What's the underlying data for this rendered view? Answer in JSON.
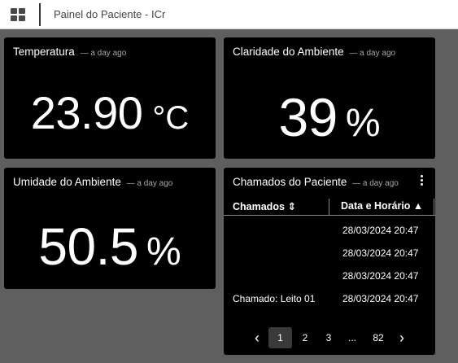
{
  "topbar": {
    "title": "Painel do Paciente - ICr"
  },
  "cards": {
    "temperature": {
      "title": "Temperatura",
      "ago": "— a day ago",
      "value": "23.90",
      "unit": "°C"
    },
    "brightness": {
      "title": "Claridade do Ambiente",
      "ago": "— a day ago",
      "value": "39",
      "unit": "%"
    },
    "humidity": {
      "title": "Umidade do Ambiente",
      "ago": "— a day ago",
      "value": "50.5",
      "unit": "%"
    },
    "calls": {
      "title": "Chamados do Paciente",
      "ago": "— a day ago",
      "columns": {
        "calls": "Chamados ⇕",
        "datetime": "Data e Horário ▲"
      },
      "rows": [
        {
          "call": "",
          "datetime": "28/03/2024 20:47"
        },
        {
          "call": "",
          "datetime": "28/03/2024 20:47"
        },
        {
          "call": "",
          "datetime": "28/03/2024 20:47"
        },
        {
          "call": "Chamado: Leito 01",
          "datetime": "28/03/2024 20:47"
        }
      ],
      "pagination": {
        "prev": "‹",
        "p1": "1",
        "p2": "2",
        "p3": "3",
        "ellipsis": "...",
        "last": "82",
        "next": "›",
        "current": 1
      }
    }
  }
}
